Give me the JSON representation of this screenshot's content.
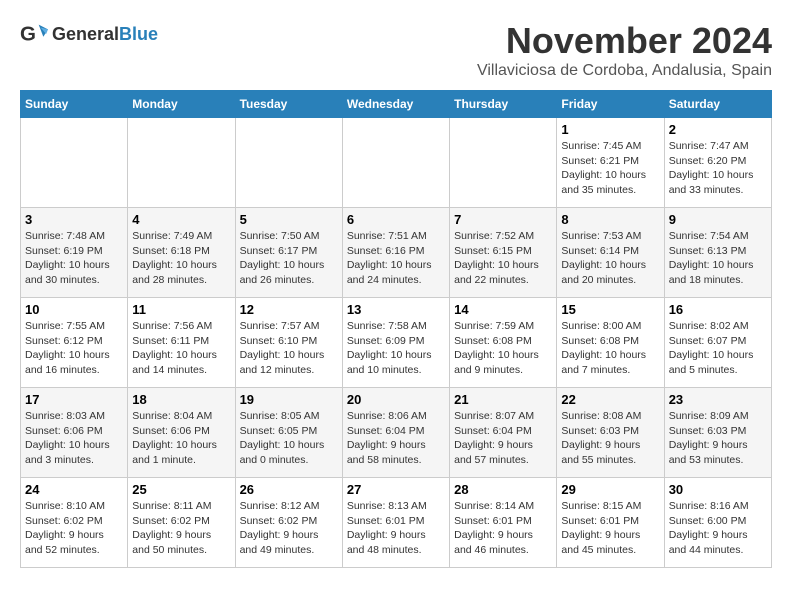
{
  "logo": {
    "text_general": "General",
    "text_blue": "Blue"
  },
  "header": {
    "month_title": "November 2024",
    "subtitle": "Villaviciosa de Cordoba, Andalusia, Spain"
  },
  "weekdays": [
    "Sunday",
    "Monday",
    "Tuesday",
    "Wednesday",
    "Thursday",
    "Friday",
    "Saturday"
  ],
  "weeks": [
    [
      {
        "day": "",
        "info": ""
      },
      {
        "day": "",
        "info": ""
      },
      {
        "day": "",
        "info": ""
      },
      {
        "day": "",
        "info": ""
      },
      {
        "day": "",
        "info": ""
      },
      {
        "day": "1",
        "info": "Sunrise: 7:45 AM\nSunset: 6:21 PM\nDaylight: 10 hours and 35 minutes."
      },
      {
        "day": "2",
        "info": "Sunrise: 7:47 AM\nSunset: 6:20 PM\nDaylight: 10 hours and 33 minutes."
      }
    ],
    [
      {
        "day": "3",
        "info": "Sunrise: 7:48 AM\nSunset: 6:19 PM\nDaylight: 10 hours and 30 minutes."
      },
      {
        "day": "4",
        "info": "Sunrise: 7:49 AM\nSunset: 6:18 PM\nDaylight: 10 hours and 28 minutes."
      },
      {
        "day": "5",
        "info": "Sunrise: 7:50 AM\nSunset: 6:17 PM\nDaylight: 10 hours and 26 minutes."
      },
      {
        "day": "6",
        "info": "Sunrise: 7:51 AM\nSunset: 6:16 PM\nDaylight: 10 hours and 24 minutes."
      },
      {
        "day": "7",
        "info": "Sunrise: 7:52 AM\nSunset: 6:15 PM\nDaylight: 10 hours and 22 minutes."
      },
      {
        "day": "8",
        "info": "Sunrise: 7:53 AM\nSunset: 6:14 PM\nDaylight: 10 hours and 20 minutes."
      },
      {
        "day": "9",
        "info": "Sunrise: 7:54 AM\nSunset: 6:13 PM\nDaylight: 10 hours and 18 minutes."
      }
    ],
    [
      {
        "day": "10",
        "info": "Sunrise: 7:55 AM\nSunset: 6:12 PM\nDaylight: 10 hours and 16 minutes."
      },
      {
        "day": "11",
        "info": "Sunrise: 7:56 AM\nSunset: 6:11 PM\nDaylight: 10 hours and 14 minutes."
      },
      {
        "day": "12",
        "info": "Sunrise: 7:57 AM\nSunset: 6:10 PM\nDaylight: 10 hours and 12 minutes."
      },
      {
        "day": "13",
        "info": "Sunrise: 7:58 AM\nSunset: 6:09 PM\nDaylight: 10 hours and 10 minutes."
      },
      {
        "day": "14",
        "info": "Sunrise: 7:59 AM\nSunset: 6:08 PM\nDaylight: 10 hours and 9 minutes."
      },
      {
        "day": "15",
        "info": "Sunrise: 8:00 AM\nSunset: 6:08 PM\nDaylight: 10 hours and 7 minutes."
      },
      {
        "day": "16",
        "info": "Sunrise: 8:02 AM\nSunset: 6:07 PM\nDaylight: 10 hours and 5 minutes."
      }
    ],
    [
      {
        "day": "17",
        "info": "Sunrise: 8:03 AM\nSunset: 6:06 PM\nDaylight: 10 hours and 3 minutes."
      },
      {
        "day": "18",
        "info": "Sunrise: 8:04 AM\nSunset: 6:06 PM\nDaylight: 10 hours and 1 minute."
      },
      {
        "day": "19",
        "info": "Sunrise: 8:05 AM\nSunset: 6:05 PM\nDaylight: 10 hours and 0 minutes."
      },
      {
        "day": "20",
        "info": "Sunrise: 8:06 AM\nSunset: 6:04 PM\nDaylight: 9 hours and 58 minutes."
      },
      {
        "day": "21",
        "info": "Sunrise: 8:07 AM\nSunset: 6:04 PM\nDaylight: 9 hours and 57 minutes."
      },
      {
        "day": "22",
        "info": "Sunrise: 8:08 AM\nSunset: 6:03 PM\nDaylight: 9 hours and 55 minutes."
      },
      {
        "day": "23",
        "info": "Sunrise: 8:09 AM\nSunset: 6:03 PM\nDaylight: 9 hours and 53 minutes."
      }
    ],
    [
      {
        "day": "24",
        "info": "Sunrise: 8:10 AM\nSunset: 6:02 PM\nDaylight: 9 hours and 52 minutes."
      },
      {
        "day": "25",
        "info": "Sunrise: 8:11 AM\nSunset: 6:02 PM\nDaylight: 9 hours and 50 minutes."
      },
      {
        "day": "26",
        "info": "Sunrise: 8:12 AM\nSunset: 6:02 PM\nDaylight: 9 hours and 49 minutes."
      },
      {
        "day": "27",
        "info": "Sunrise: 8:13 AM\nSunset: 6:01 PM\nDaylight: 9 hours and 48 minutes."
      },
      {
        "day": "28",
        "info": "Sunrise: 8:14 AM\nSunset: 6:01 PM\nDaylight: 9 hours and 46 minutes."
      },
      {
        "day": "29",
        "info": "Sunrise: 8:15 AM\nSunset: 6:01 PM\nDaylight: 9 hours and 45 minutes."
      },
      {
        "day": "30",
        "info": "Sunrise: 8:16 AM\nSunset: 6:00 PM\nDaylight: 9 hours and 44 minutes."
      }
    ]
  ]
}
